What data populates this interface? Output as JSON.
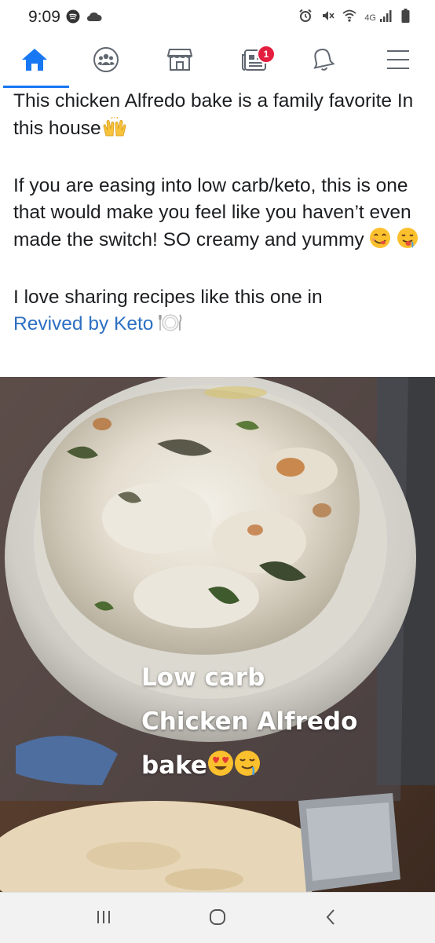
{
  "status_bar": {
    "time": "9:09",
    "network": "4G"
  },
  "nav": {
    "items": [
      {
        "name": "home",
        "icon": "home-icon",
        "active": true
      },
      {
        "name": "groups",
        "icon": "groups-icon"
      },
      {
        "name": "marketplace",
        "icon": "marketplace-icon"
      },
      {
        "name": "news",
        "icon": "news-icon",
        "badge": "1"
      },
      {
        "name": "notifications",
        "icon": "bell-icon"
      },
      {
        "name": "menu",
        "icon": "hamburger-menu-icon"
      }
    ],
    "accent_color": "#1877f2",
    "badge_color": "#e41e3f"
  },
  "post": {
    "para1": "This chicken Alfredo bake is a family favorite In this house",
    "para2": "If you are easing into low carb/keto, this is one that would make you feel like you haven’t even made the switch! SO creamy and yummy",
    "para3_prefix": "I love sharing recipes like this one in",
    "group_link": "Revived by Keto",
    "link_color": "#2d6fc2"
  },
  "photo": {
    "caption_line1": "Low carb",
    "caption_line2": "Chicken Alfredo",
    "caption_line3": "bake"
  },
  "system_nav": {
    "recents_icon": "recents-icon",
    "home_icon": "home-circle-icon",
    "back_icon": "back-chevron-icon"
  }
}
